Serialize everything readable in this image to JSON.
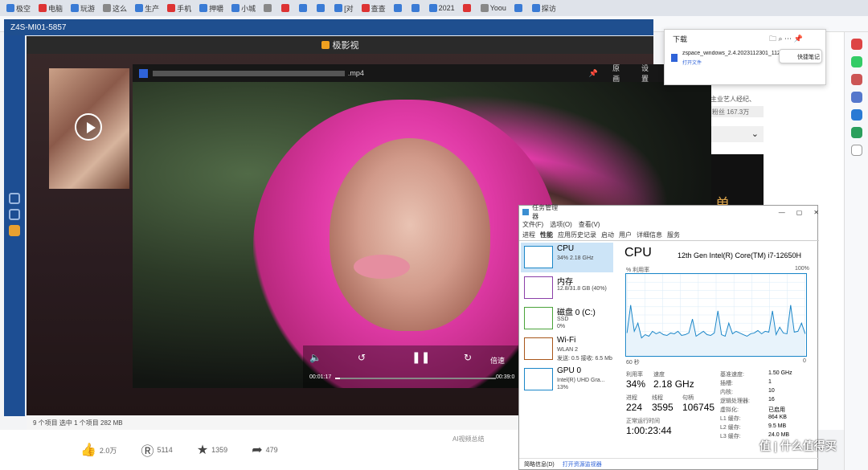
{
  "tabs": [
    "极空",
    "电脑",
    "玩游",
    "这么",
    "生产",
    "手机",
    "押嚼",
    "小城",
    "",
    "",
    "",
    "",
    "[对",
    "查查",
    "",
    "",
    "2021",
    "",
    "Yoou",
    "",
    "探访"
  ],
  "zspace": {
    "title": "Z4S-MI01-5857"
  },
  "player": {
    "title": "极影视",
    "status": "9 个项目    选中 1 个项目  282 MB"
  },
  "video": {
    "filename": ".mp4",
    "btn_original": "原画",
    "btn_settings": "设置",
    "time_current": "00:01:17",
    "time_total": "00:39:0",
    "speed": "倍速",
    "progress": 0.03
  },
  "download": {
    "title": "下载",
    "filename": "zspace_windows_2.4.2023112301_112",
    "open": "打开文件",
    "quicknote": "快捷笔记"
  },
  "page": {
    "snip1": "主业艺人经纪、",
    "snip2": "粉丝 167.3万",
    "big_char": "单"
  },
  "reactions": [
    {
      "sym": "👍",
      "val": "2.0万"
    },
    {
      "sym": "Ⓡ",
      "val": "5114"
    },
    {
      "sym": "★",
      "val": "1359"
    },
    {
      "sym": "➦",
      "val": "479"
    }
  ],
  "ai_note": "AI视频总结",
  "taskmgr": {
    "title": "任务管理器",
    "menu": [
      "文件(F)",
      "选项(O)",
      "查看(V)"
    ],
    "tabs": [
      "进程",
      "性能",
      "应用历史记录",
      "启动",
      "用户",
      "详细信息",
      "服务"
    ],
    "items": [
      {
        "name": "CPU",
        "s1": "34%  2.18 GHz",
        "s2": ""
      },
      {
        "name": "内存",
        "s1": "12.8/31.8 GB (40%)",
        "s2": ""
      },
      {
        "name": "磁盘 0 (C:)",
        "s1": "SSD",
        "s2": "0%"
      },
      {
        "name": "Wi-Fi",
        "s1": "WLAN 2",
        "s2": "发送: 0.5  接收: 6.5 Mb"
      },
      {
        "name": "GPU 0",
        "s1": "Intel(R) UHD Gra...",
        "s2": "13%"
      }
    ],
    "cpu_title": "CPU",
    "cpu_name": "12th Gen Intel(R) Core(TM) i7-12650H",
    "usage_label": "% 利用率",
    "pct_max": "100%",
    "sec_label": "60 秒",
    "zero": "0",
    "stats": {
      "util_label": "利用率",
      "util": "34%",
      "speed_label": "速度",
      "speed": "2.18 GHz",
      "proc_label": "进程",
      "proc": "224",
      "thread_label": "线程",
      "thread": "3595",
      "handle_label": "句柄",
      "handle": "106745",
      "uptime_label": "正常运行时间",
      "uptime": "1:00:23:44"
    },
    "specs": [
      [
        "基准速度:",
        "1.50 GHz"
      ],
      [
        "插槽:",
        "1"
      ],
      [
        "内核:",
        "10"
      ],
      [
        "逻辑处理器:",
        "16"
      ],
      [
        "虚拟化:",
        "已启用"
      ],
      [
        "L1 缓存:",
        "864 KB"
      ],
      [
        "L2 缓存:",
        "9.5 MB"
      ],
      [
        "L3 缓存:",
        "24.0 MB"
      ]
    ],
    "foot_brief": "简略信息(D)",
    "foot_monitor": "打开资源监视器",
    "cpu_series": [
      28,
      62,
      30,
      40,
      22,
      26,
      24,
      30,
      27,
      29,
      26,
      25,
      28,
      27,
      30,
      25,
      26,
      28,
      45,
      24,
      27,
      30,
      26,
      25,
      28,
      55,
      26,
      24,
      40,
      27,
      30,
      28,
      26,
      24,
      27,
      28,
      31,
      27,
      30,
      29,
      55,
      26,
      35,
      28,
      27,
      62,
      29,
      30,
      40,
      27
    ]
  },
  "watermark": "值 | 什么值得买"
}
